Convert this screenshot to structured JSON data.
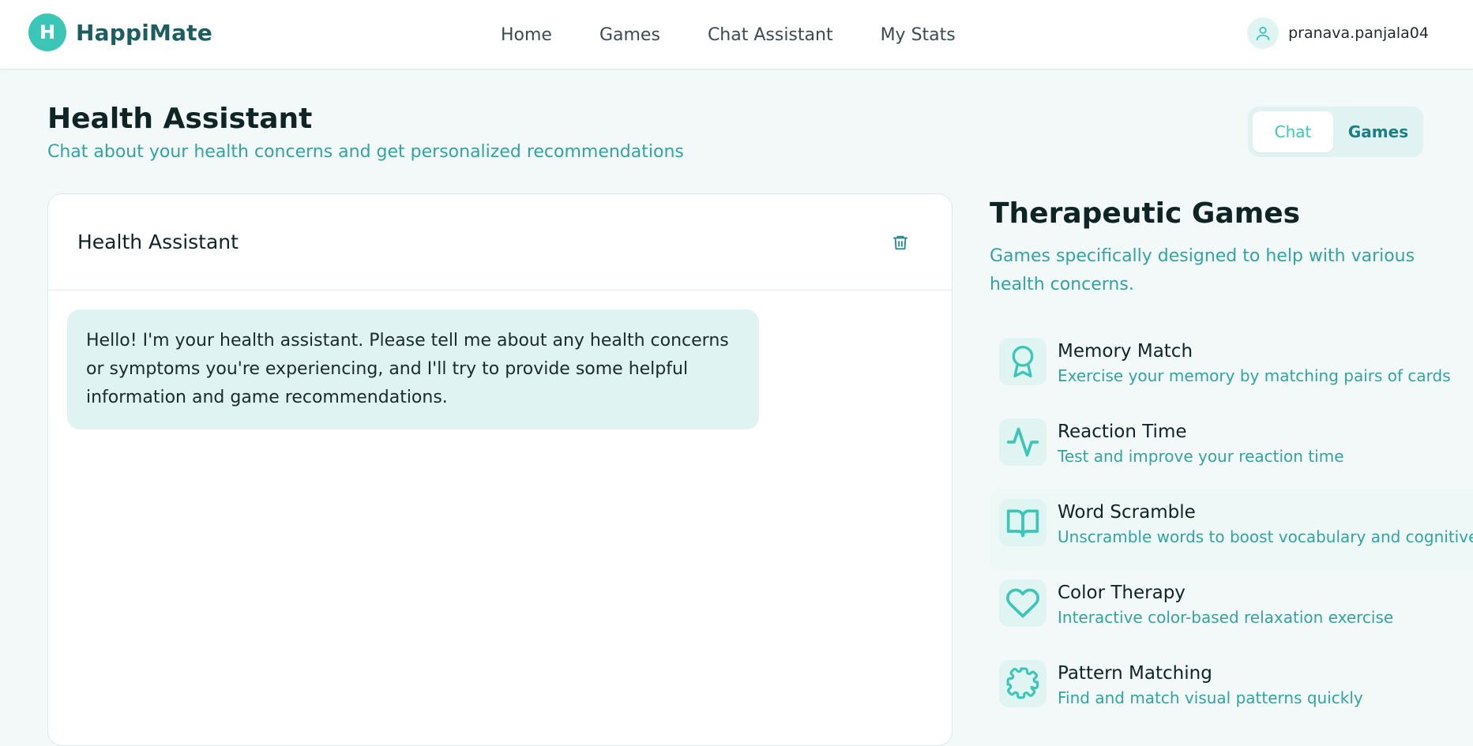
{
  "navbar": {
    "logo_letter": "H",
    "brand": "HappiMate",
    "links": [
      {
        "label": "Home"
      },
      {
        "label": "Games"
      },
      {
        "label": "Chat Assistant"
      },
      {
        "label": "My Stats"
      }
    ],
    "user": {
      "name": "pranava.panjala04",
      "icon": "user-icon"
    }
  },
  "page": {
    "title": "Health Assistant",
    "subtitle": "Chat about your health concerns and get personalized recommendations",
    "toggle": {
      "chat_label": "Chat",
      "games_label": "Games",
      "active": "Chat"
    }
  },
  "chat": {
    "title": "Health Assistant",
    "clear_icon": "trash-icon",
    "messages": [
      {
        "role": "assistant",
        "text": "Hello! I'm your health assistant. Please tell me about any health concerns or symptoms you're experiencing, and I'll try to provide some helpful information and game recommendations."
      }
    ]
  },
  "games_panel": {
    "title": "Therapeutic Games",
    "subtitle": "Games specifically designed to help with various health concerns.",
    "games": [
      {
        "name": "Memory Match",
        "description": "Exercise your memory by matching pairs of cards",
        "icon": "award-icon"
      },
      {
        "name": "Reaction Time",
        "description": "Test and improve your reaction time",
        "icon": "activity-icon"
      },
      {
        "name": "Word Scramble",
        "description": "Unscramble words to boost vocabulary and cognitive skills",
        "icon": "book-open-icon"
      },
      {
        "name": "Color Therapy",
        "description": "Interactive color-based relaxation exercise",
        "icon": "heart-icon"
      },
      {
        "name": "Pattern Matching",
        "description": "Find and match visual patterns quickly",
        "icon": "puzzle-icon"
      }
    ]
  },
  "colors": {
    "accent": "#3cc6b8",
    "brand_text": "#1d5d60",
    "subtitle_teal": "#32a3a0",
    "bubble_bg": "#dff3f2",
    "page_bg": "#f3f9f9"
  }
}
